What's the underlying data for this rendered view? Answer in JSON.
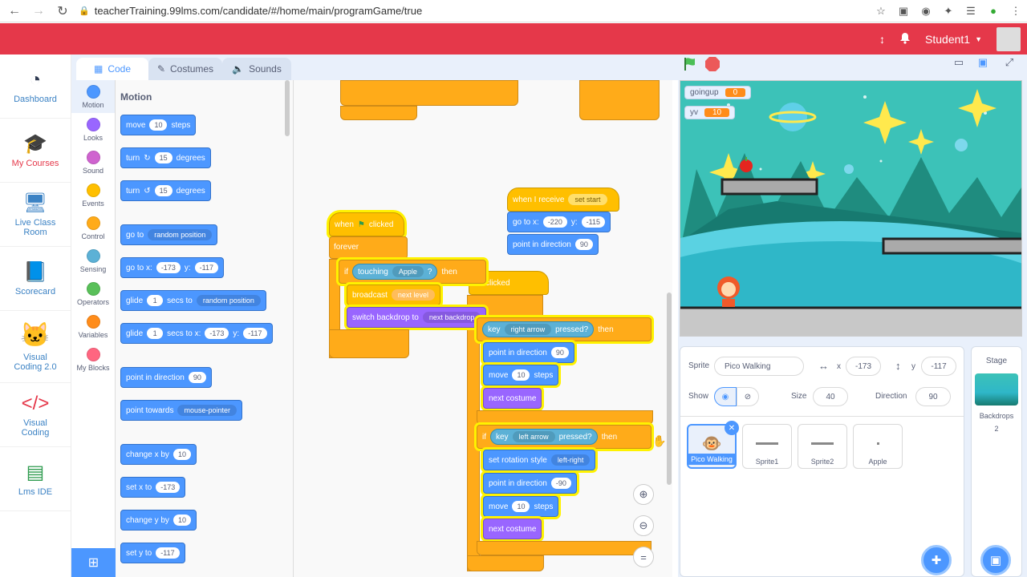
{
  "browser": {
    "url": "teacherTraining.99lms.com/candidate/#/home/main/programGame/true"
  },
  "header": {
    "user": "Student1"
  },
  "lms_nav": [
    {
      "label": "Dashboard",
      "icon": "gauge-icon"
    },
    {
      "label": "My Courses",
      "icon": "graduation-cap-icon"
    },
    {
      "label": "Live Class Room",
      "icon": "monitor-icon"
    },
    {
      "label": "Scorecard",
      "icon": "book-icon"
    },
    {
      "label": "Visual Coding 2.0",
      "icon": "cat-icon"
    },
    {
      "label": "Visual Coding",
      "icon": "code-icon"
    },
    {
      "label": "Lms IDE",
      "icon": "card-icon"
    }
  ],
  "tabs": {
    "code": "Code",
    "costumes": "Costumes",
    "sounds": "Sounds"
  },
  "categories": [
    {
      "label": "Motion",
      "color": "#4c97ff"
    },
    {
      "label": "Looks",
      "color": "#9966ff"
    },
    {
      "label": "Sound",
      "color": "#cf63cf"
    },
    {
      "label": "Events",
      "color": "#ffbf00"
    },
    {
      "label": "Control",
      "color": "#ffab19"
    },
    {
      "label": "Sensing",
      "color": "#5cb1d6"
    },
    {
      "label": "Operators",
      "color": "#59c059"
    },
    {
      "label": "Variables",
      "color": "#ff8c1a"
    },
    {
      "label": "My Blocks",
      "color": "#ff6680"
    }
  ],
  "palette": {
    "title": "Motion",
    "move": {
      "a": "move",
      "v": "10",
      "b": "steps"
    },
    "turn_cw": {
      "a": "turn",
      "v": "15",
      "b": "degrees"
    },
    "turn_ccw": {
      "a": "turn",
      "v": "15",
      "b": "degrees"
    },
    "goto": {
      "a": "go to",
      "d": "random position"
    },
    "gotoxy": {
      "a": "go to x:",
      "x": "-173",
      "y_label": "y:",
      "y": "-117"
    },
    "glide1": {
      "a": "glide",
      "v": "1",
      "b": "secs to",
      "d": "random position"
    },
    "glide2": {
      "a": "glide",
      "v": "1",
      "b": "secs to x:",
      "x": "-173",
      "y_label": "y:",
      "y": "-117"
    },
    "point_dir": {
      "a": "point in direction",
      "v": "90"
    },
    "point_towards": {
      "a": "point towards",
      "d": "mouse-pointer"
    },
    "change_x": {
      "a": "change x by",
      "v": "10"
    },
    "set_x": {
      "a": "set x to",
      "v": "-173"
    },
    "change_y": {
      "a": "change y by",
      "v": "10"
    },
    "set_y": {
      "a": "set y to",
      "v": "-117"
    }
  },
  "script": {
    "recv": {
      "a": "when I receive",
      "d": "set start"
    },
    "recv_goto": {
      "a": "go to x:",
      "x": "-220",
      "y_label": "y:",
      "y": "-115"
    },
    "recv_point": {
      "a": "point in direction",
      "v": "90"
    },
    "flag1": {
      "a": "when",
      "b": "clicked"
    },
    "forever": "forever",
    "if1": {
      "a": "if",
      "b": "touching",
      "d": "Apple",
      "q": "?",
      "c": "then"
    },
    "broadcast": {
      "a": "broadcast",
      "d": "next level"
    },
    "switch_bd": {
      "a": "switch backdrop to",
      "d": "next backdrop"
    },
    "flag2": {
      "b": "clicked"
    },
    "if2": {
      "a": "key",
      "d": "right arrow",
      "b": "pressed?",
      "c": "then"
    },
    "if2_point": {
      "a": "point in direction",
      "v": "90"
    },
    "if2_move": {
      "a": "move",
      "v": "10",
      "b": "steps"
    },
    "if2_next": "next costume",
    "if3": {
      "i": "if",
      "a": "key",
      "d": "left arrow",
      "b": "pressed?",
      "c": "then"
    },
    "if3_rot": {
      "a": "set rotation style",
      "d": "left-right"
    },
    "if3_point": {
      "a": "point in direction",
      "v": "-90"
    },
    "if3_move": {
      "a": "move",
      "v": "10",
      "b": "steps"
    },
    "if3_next": "next costume"
  },
  "stage": {
    "monitors": [
      {
        "name": "goingup",
        "value": "0"
      },
      {
        "name": "yv",
        "value": "10"
      }
    ]
  },
  "sprite_info": {
    "sprite_label": "Sprite",
    "sprite_name": "Pico Walking",
    "x_label": "x",
    "x": "-173",
    "y_label": "y",
    "y": "-117",
    "show_label": "Show",
    "size_label": "Size",
    "size": "40",
    "direction_label": "Direction",
    "direction": "90",
    "sprites": [
      "Pico Walking",
      "Sprite1",
      "Sprite2",
      "Apple"
    ]
  },
  "stage_pane": {
    "title": "Stage",
    "backdrops_label": "Backdrops",
    "backdrops": "2"
  }
}
